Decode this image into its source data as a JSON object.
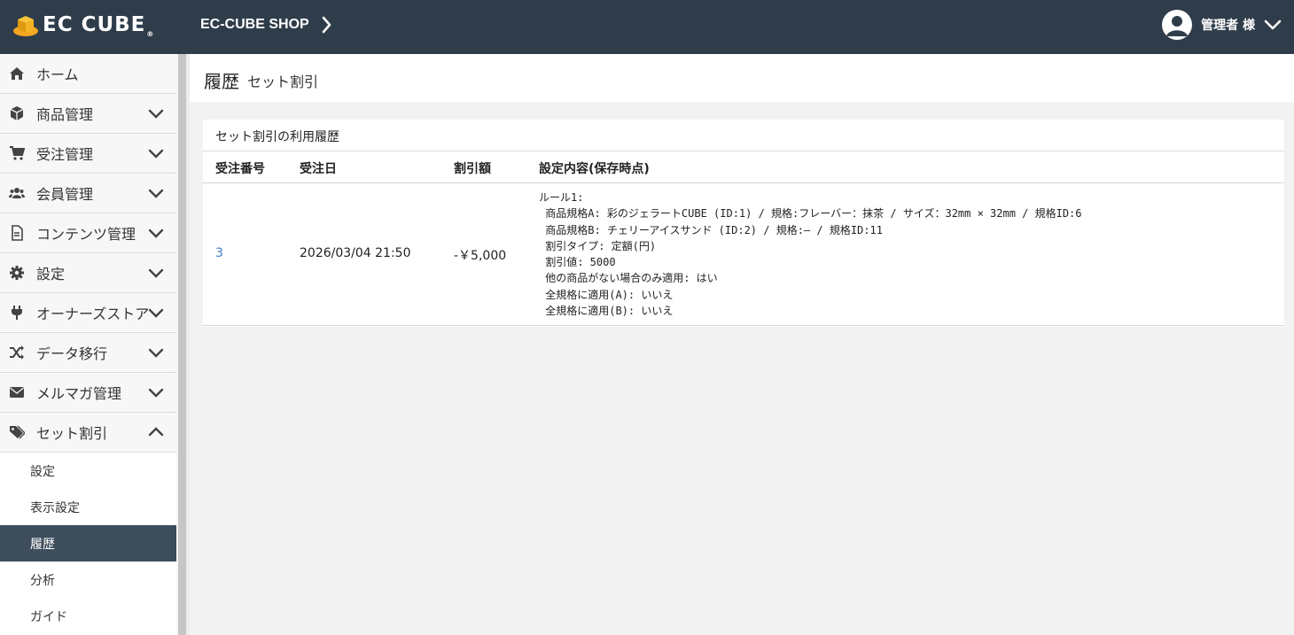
{
  "header": {
    "logo_text": "EC CUBE",
    "logo_reg": "®",
    "shop_name": "EC-CUBE SHOP",
    "user_name": "管理者 様"
  },
  "sidebar": {
    "items": [
      {
        "label": "ホーム",
        "icon": "home-icon"
      },
      {
        "label": "商品管理",
        "icon": "box-icon"
      },
      {
        "label": "受注管理",
        "icon": "cart-icon"
      },
      {
        "label": "会員管理",
        "icon": "users-icon"
      },
      {
        "label": "コンテンツ管理",
        "icon": "file-icon"
      },
      {
        "label": "設定",
        "icon": "gear-icon"
      },
      {
        "label": "オーナーズストア",
        "icon": "plug-icon"
      },
      {
        "label": "データ移行",
        "icon": "shuffle-icon"
      },
      {
        "label": "メルマガ管理",
        "icon": "mail-icon"
      },
      {
        "label": "セット割引",
        "icon": "tags-icon"
      }
    ],
    "sub_items": [
      {
        "label": "設定"
      },
      {
        "label": "表示設定"
      },
      {
        "label": "履歴",
        "active": true
      },
      {
        "label": "分析"
      },
      {
        "label": "ガイド"
      }
    ]
  },
  "page": {
    "title": "履歴",
    "subtitle": "セット割引"
  },
  "card": {
    "title": "セット割引の利用履歴",
    "columns": [
      "受注番号",
      "受注日",
      "割引額",
      "設定内容(保存時点)"
    ],
    "rows": [
      {
        "order_no": "3",
        "order_date": "2026/03/04 21:50",
        "discount": "-￥5,000",
        "detail": "ルール1:\n 商品規格A: 彩のジェラートCUBE (ID:1) / 規格:フレーバー：抹茶 / サイズ：32mm × 32mm / 規格ID:6\n 商品規格B: チェリーアイスサンド (ID:2) / 規格:– / 規格ID:11\n 割引タイプ: 定額(円)\n 割引値: 5000\n 他の商品がない場合のみ適用: はい\n 全規格に適用(A): いいえ\n 全規格に適用(B): いいえ"
      }
    ]
  },
  "colors": {
    "header_bg": "#2f3d4b",
    "active_bg": "#3e4d5c",
    "link": "#437ec4"
  }
}
